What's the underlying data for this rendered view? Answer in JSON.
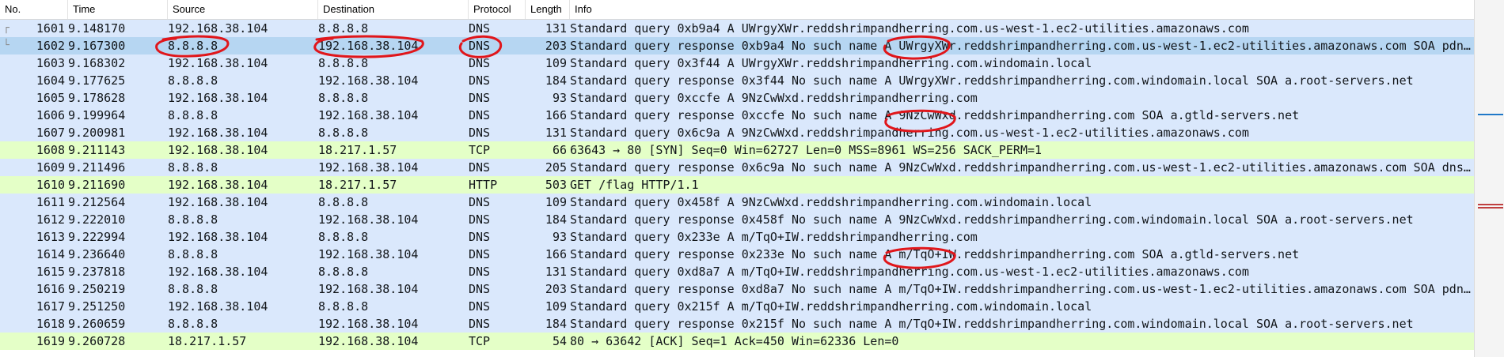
{
  "columns": {
    "no": "No.",
    "time": "Time",
    "source": "Source",
    "destination": "Destination",
    "protocol": "Protocol",
    "length": "Length",
    "info": "Info"
  },
  "colors": {
    "dns": "#dae8fc",
    "tcp": "#e4ffc7",
    "http": "#e4ffc7",
    "selected": "#b6d6f2",
    "annotation": "#e0161b"
  },
  "packets": [
    {
      "no": "1601",
      "time": "9.148170",
      "source": "192.168.38.104",
      "destination": "8.8.8.8",
      "protocol": "DNS",
      "length": "131",
      "info": "Standard query 0xb9a4 A UWrgyXWr.reddshrimpandherring.com.us-west-1.ec2-utilities.amazonaws.com",
      "kind": "dns"
    },
    {
      "no": "1602",
      "time": "9.167300",
      "source": "8.8.8.8",
      "destination": "192.168.38.104",
      "protocol": "DNS",
      "length": "203",
      "info": "Standard query response 0xb9a4 No such name A UWrgyXWr.reddshrimpandherring.com.us-west-1.ec2-utilities.amazonaws.com SOA pdns…",
      "kind": "selected"
    },
    {
      "no": "1603",
      "time": "9.168302",
      "source": "192.168.38.104",
      "destination": "8.8.8.8",
      "protocol": "DNS",
      "length": "109",
      "info": "Standard query 0x3f44 A UWrgyXWr.reddshrimpandherring.com.windomain.local",
      "kind": "dns"
    },
    {
      "no": "1604",
      "time": "9.177625",
      "source": "8.8.8.8",
      "destination": "192.168.38.104",
      "protocol": "DNS",
      "length": "184",
      "info": "Standard query response 0x3f44 No such name A UWrgyXWr.reddshrimpandherring.com.windomain.local SOA a.root-servers.net",
      "kind": "dns"
    },
    {
      "no": "1605",
      "time": "9.178628",
      "source": "192.168.38.104",
      "destination": "8.8.8.8",
      "protocol": "DNS",
      "length": "93",
      "info": "Standard query 0xccfe A 9NzCwWxd.reddshrimpandherring.com",
      "kind": "dns"
    },
    {
      "no": "1606",
      "time": "9.199964",
      "source": "8.8.8.8",
      "destination": "192.168.38.104",
      "protocol": "DNS",
      "length": "166",
      "info": "Standard query response 0xccfe No such name A 9NzCwWxd.reddshrimpandherring.com SOA a.gtld-servers.net",
      "kind": "dns"
    },
    {
      "no": "1607",
      "time": "9.200981",
      "source": "192.168.38.104",
      "destination": "8.8.8.8",
      "protocol": "DNS",
      "length": "131",
      "info": "Standard query 0x6c9a A 9NzCwWxd.reddshrimpandherring.com.us-west-1.ec2-utilities.amazonaws.com",
      "kind": "dns"
    },
    {
      "no": "1608",
      "time": "9.211143",
      "source": "192.168.38.104",
      "destination": "18.217.1.57",
      "protocol": "TCP",
      "length": "66",
      "info": "63643 → 80 [SYN] Seq=0 Win=62727 Len=0 MSS=8961 WS=256 SACK_PERM=1",
      "kind": "tcp"
    },
    {
      "no": "1609",
      "time": "9.211496",
      "source": "8.8.8.8",
      "destination": "192.168.38.104",
      "protocol": "DNS",
      "length": "205",
      "info": "Standard query response 0x6c9a No such name A 9NzCwWxd.reddshrimpandherring.com.us-west-1.ec2-utilities.amazonaws.com SOA dns-…",
      "kind": "dns"
    },
    {
      "no": "1610",
      "time": "9.211690",
      "source": "192.168.38.104",
      "destination": "18.217.1.57",
      "protocol": "HTTP",
      "length": "503",
      "info": "GET /flag HTTP/1.1",
      "kind": "http"
    },
    {
      "no": "1611",
      "time": "9.212564",
      "source": "192.168.38.104",
      "destination": "8.8.8.8",
      "protocol": "DNS",
      "length": "109",
      "info": "Standard query 0x458f A 9NzCwWxd.reddshrimpandherring.com.windomain.local",
      "kind": "dns"
    },
    {
      "no": "1612",
      "time": "9.222010",
      "source": "8.8.8.8",
      "destination": "192.168.38.104",
      "protocol": "DNS",
      "length": "184",
      "info": "Standard query response 0x458f No such name A 9NzCwWxd.reddshrimpandherring.com.windomain.local SOA a.root-servers.net",
      "kind": "dns"
    },
    {
      "no": "1613",
      "time": "9.222994",
      "source": "192.168.38.104",
      "destination": "8.8.8.8",
      "protocol": "DNS",
      "length": "93",
      "info": "Standard query 0x233e A m/TqO+IW.reddshrimpandherring.com",
      "kind": "dns"
    },
    {
      "no": "1614",
      "time": "9.236640",
      "source": "8.8.8.8",
      "destination": "192.168.38.104",
      "protocol": "DNS",
      "length": "166",
      "info": "Standard query response 0x233e No such name A m/TqO+IW.reddshrimpandherring.com SOA a.gtld-servers.net",
      "kind": "dns"
    },
    {
      "no": "1615",
      "time": "9.237818",
      "source": "192.168.38.104",
      "destination": "8.8.8.8",
      "protocol": "DNS",
      "length": "131",
      "info": "Standard query 0xd8a7 A m/TqO+IW.reddshrimpandherring.com.us-west-1.ec2-utilities.amazonaws.com",
      "kind": "dns"
    },
    {
      "no": "1616",
      "time": "9.250219",
      "source": "8.8.8.8",
      "destination": "192.168.38.104",
      "protocol": "DNS",
      "length": "203",
      "info": "Standard query response 0xd8a7 No such name A m/TqO+IW.reddshrimpandherring.com.us-west-1.ec2-utilities.amazonaws.com SOA pdns…",
      "kind": "dns"
    },
    {
      "no": "1617",
      "time": "9.251250",
      "source": "192.168.38.104",
      "destination": "8.8.8.8",
      "protocol": "DNS",
      "length": "109",
      "info": "Standard query 0x215f A m/TqO+IW.reddshrimpandherring.com.windomain.local",
      "kind": "dns"
    },
    {
      "no": "1618",
      "time": "9.260659",
      "source": "8.8.8.8",
      "destination": "192.168.38.104",
      "protocol": "DNS",
      "length": "184",
      "info": "Standard query response 0x215f No such name A m/TqO+IW.reddshrimpandherring.com.windomain.local SOA a.root-servers.net",
      "kind": "dns"
    },
    {
      "no": "1619",
      "time": "9.260728",
      "source": "18.217.1.57",
      "destination": "192.168.38.104",
      "protocol": "TCP",
      "length": "54",
      "info": "80 → 63642 [ACK] Seq=1 Ack=450 Win=62336 Len=0",
      "kind": "tcp"
    }
  ]
}
